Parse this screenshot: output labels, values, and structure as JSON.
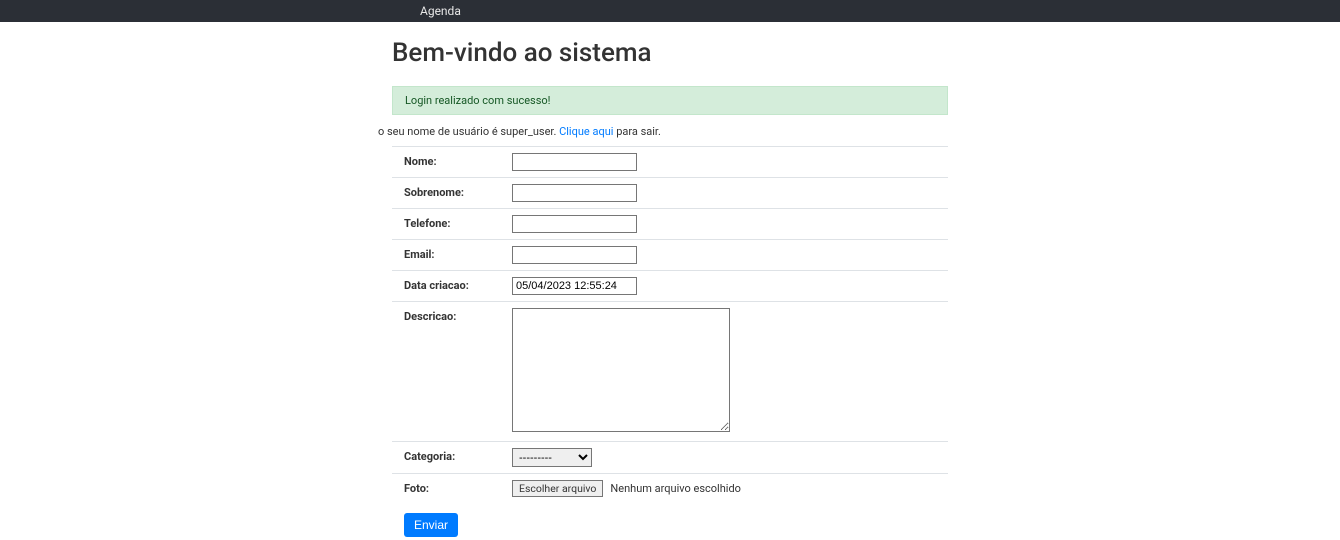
{
  "navbar": {
    "brand": "Agenda"
  },
  "page": {
    "title": "Bem-vindo ao sistema"
  },
  "alert": {
    "message": "Login realizado com sucesso!"
  },
  "info": {
    "prefix": "o seu nome de usuário é super_user. ",
    "link_text": "Clique aqui",
    "suffix": " para sair."
  },
  "form": {
    "nome": {
      "label": "Nome:",
      "value": ""
    },
    "sobrenome": {
      "label": "Sobrenome:",
      "value": ""
    },
    "telefone": {
      "label": "Telefone:",
      "value": ""
    },
    "email": {
      "label": "Email:",
      "value": ""
    },
    "data_criacao": {
      "label": "Data criacao:",
      "value": "05/04/2023 12:55:24"
    },
    "descricao": {
      "label": "Descricao:",
      "value": ""
    },
    "categoria": {
      "label": "Categoria:",
      "selected": "---------"
    },
    "foto": {
      "label": "Foto:",
      "button_text": "Escolher arquivo",
      "status_text": "Nenhum arquivo escolhido"
    },
    "submit": "Enviar"
  }
}
